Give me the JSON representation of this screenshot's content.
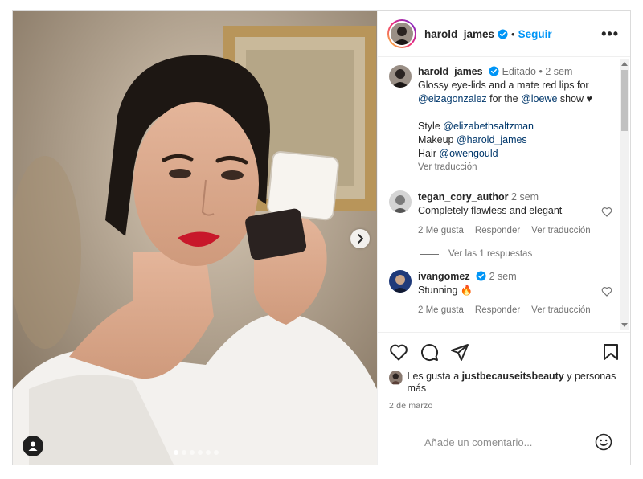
{
  "post": {
    "author": {
      "username": "harold_james",
      "verified": true,
      "follow_label": "Seguir",
      "more_label": "•••"
    },
    "caption": {
      "username": "harold_james",
      "edited_label": "Editado",
      "separator": "•",
      "time": "2 sem",
      "line1_text": "Glossy eye-lids and a mate red lips for",
      "mention1": "@eizagonzalez",
      "line2_mid": " for the ",
      "mention2": "@loewe",
      "line2_end": " show ♥",
      "style_label": "Style ",
      "style_mention": "@elizabethsaltzman",
      "makeup_label": "Makeup ",
      "makeup_mention": "@harold_james",
      "hair_label": "Hair ",
      "hair_mention": "@owengould",
      "translate": "Ver traducción"
    },
    "comments": [
      {
        "username": "tegan_cory_author",
        "time": "2 sem",
        "text": "Completely flawless and elegant",
        "likes": "2 Me gusta",
        "reply": "Responder",
        "translate": "Ver traducción",
        "view_replies": "Ver las 1 respuestas"
      },
      {
        "username": "ivangomez",
        "verified": true,
        "time": "2 sem",
        "text": "Stunning 🔥",
        "likes": "2 Me gusta",
        "reply": "Responder",
        "translate": "Ver traducción"
      }
    ],
    "likes": {
      "prefix": "Les gusta a ",
      "user": "justbecauseitsbeauty",
      "suffix": " y personas más"
    },
    "date": "2 de marzo",
    "add_comment_placeholder": "Añade un comentario...",
    "carousel": {
      "total": 6,
      "active": 0
    }
  },
  "colors": {
    "accent": "#0095f6",
    "mention": "#00376b",
    "lips": "#c8182a"
  },
  "icons": [
    "heart-icon",
    "comment-icon",
    "share-icon",
    "bookmark-icon",
    "emoji-icon",
    "verified-icon",
    "chevron-right-icon",
    "user-tag-icon"
  ]
}
